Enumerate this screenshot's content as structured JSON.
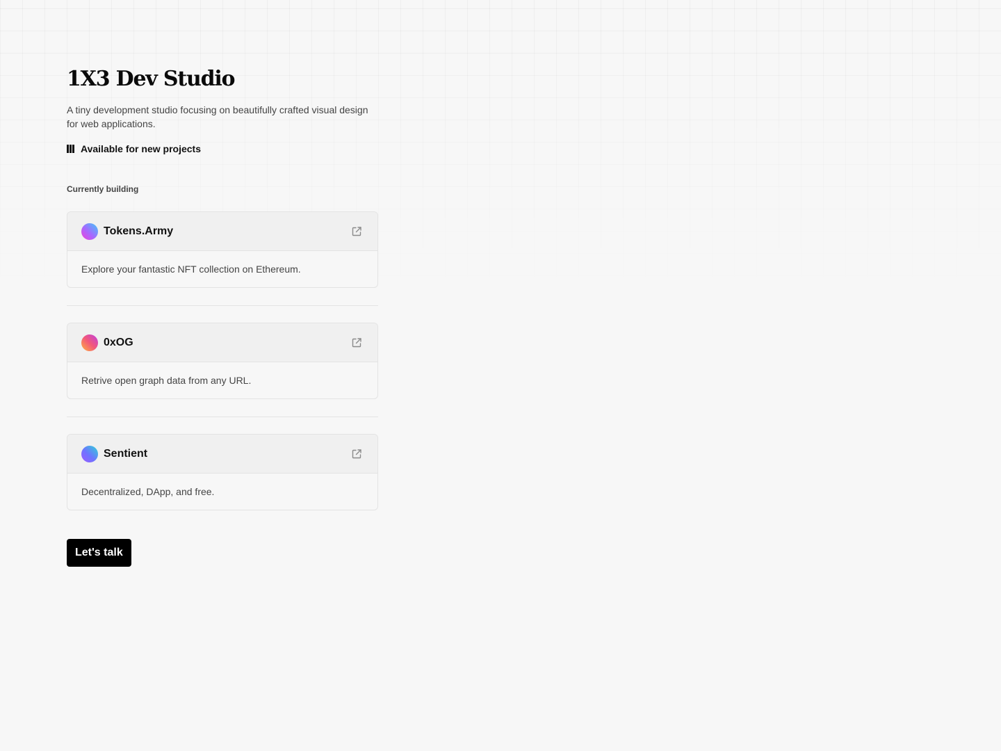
{
  "studio": {
    "title": "1X3 Dev Studio",
    "description": "A tiny development studio focusing on beautifully crafted visual design for web applications.",
    "availability": "Available for new projects",
    "availability_icon": "bars-icon"
  },
  "projects_section": {
    "label": "Currently building",
    "projects": [
      {
        "name": "Tokens.Army",
        "description": "Explore your fantastic NFT collection on Ethereum.",
        "link_icon": "external-link-icon",
        "avatar_colors": [
          "#f03fd8",
          "#a768ff",
          "#3fc9f8"
        ]
      },
      {
        "name": "0xOG",
        "description": "Retrive open graph data from any URL.",
        "link_icon": "external-link-icon",
        "avatar_colors": [
          "#ffb23f",
          "#f2587a",
          "#c03fe0"
        ]
      },
      {
        "name": "Sentient",
        "description": "Decentralized, DApp, and free.",
        "link_icon": "external-link-icon",
        "avatar_colors": [
          "#9b5cff",
          "#6e74ff",
          "#2fd3d8"
        ]
      }
    ]
  },
  "cta": {
    "label": "Let's talk"
  },
  "colors": {
    "background": "#f7f7f7",
    "text": "#111111",
    "muted_text": "#444444",
    "border": "#e3e3e3",
    "card_header": "#f0f0f0",
    "button_bg": "#000000",
    "button_text": "#ffffff"
  }
}
